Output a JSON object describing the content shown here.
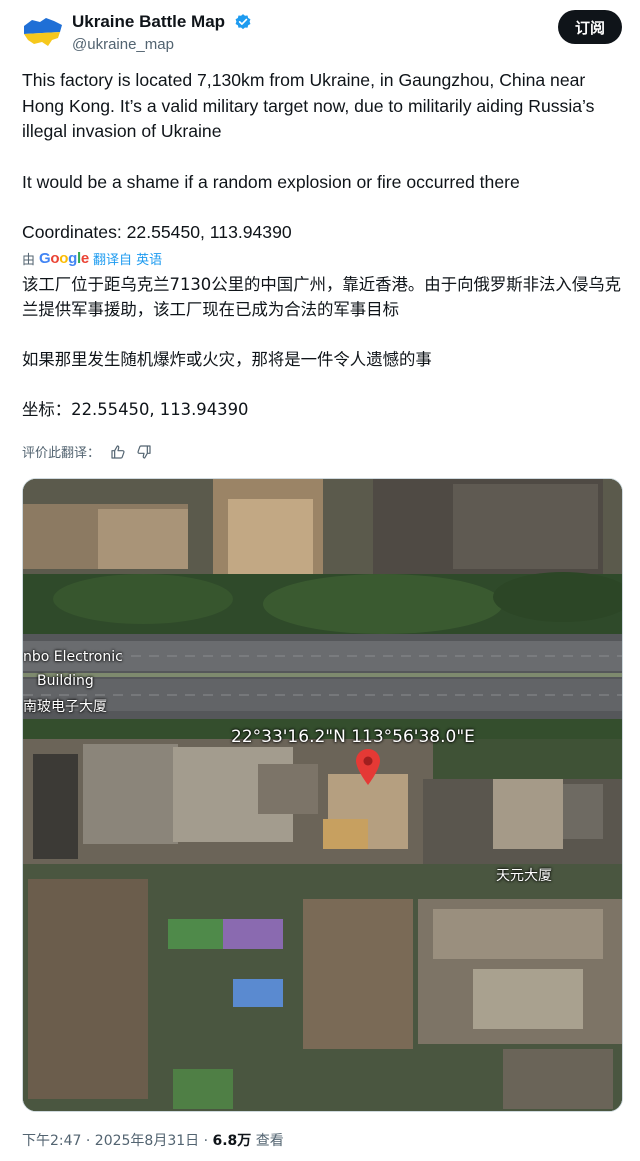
{
  "author": {
    "display_name": "Ukraine Battle Map",
    "handle": "@ukraine_map",
    "avatar_icon": "ukraine-map-flag-icon",
    "verified_icon": "verified-badge-icon"
  },
  "subscribe_label": "订阅",
  "tweet": {
    "line1": "This factory is located 7,130km from Ukraine, in Gaungzhou, China near Hong Kong. It’s a valid military target now, due to militarily aiding Russia’s illegal invasion of Ukraine",
    "line2": "It would be a shame if a random explosion or fire occurred there",
    "line3": "Coordinates: 22.55450, 113.94390"
  },
  "translation": {
    "by": "由",
    "google": [
      "G",
      "o",
      "o",
      "g",
      "l",
      "e"
    ],
    "link": "翻译自 英语",
    "zh1": "该工厂位于距乌克兰7130公里的中国广州，靠近香港。由于向俄罗斯非法入侵乌克兰提供军事援助，该工厂现在已成为合法的军事目标",
    "zh2": "如果那里发生随机爆炸或火灾，那将是一件令人遗憾的事",
    "zh3": "坐标：22.55450, 113.94390",
    "rate_label": "评价此翻译：",
    "thumb_up_icon": "thumbs-up-icon",
    "thumb_down_icon": "thumbs-down-icon"
  },
  "media": {
    "coords_label": "22°33'16.2\"N 113°56'38.0\"E",
    "building_label_1": "nbo Electronic",
    "building_label_2": "Building",
    "building_label_3": "南玻电子大厦",
    "building_label_4": "天元大厦",
    "pin_icon": "map-pin-icon"
  },
  "footer": {
    "time": "下午2:47 · 2025年8月31日 · ",
    "views": "6.8万",
    "views_label": " 查看"
  },
  "colors": {
    "ukraine_blue": "#1f6fd6",
    "ukraine_yellow": "#f6c81c",
    "verified_blue": "#1d9bf0",
    "pin_red": "#e53935"
  }
}
